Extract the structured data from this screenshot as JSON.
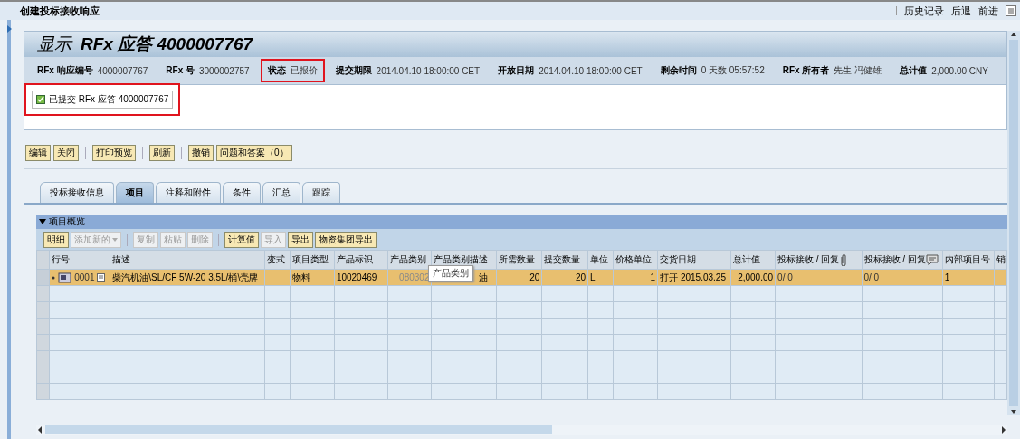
{
  "window": {
    "title": "创建投标接收响应"
  },
  "nav": [
    "历史记录",
    "后退",
    "前进"
  ],
  "header": {
    "title_prefix": "显示",
    "title": "RFx 应答 4000007767",
    "fields": [
      {
        "label": "RFx 响应编号",
        "value": "4000007767",
        "highlighted": false
      },
      {
        "label": "RFx 号",
        "value": "3000002757",
        "highlighted": false
      },
      {
        "label": "状态",
        "value": "已报价",
        "highlighted": true
      },
      {
        "label": "提交期限",
        "value": "2014.04.10 18:00:00 CET",
        "highlighted": false
      },
      {
        "label": "开放日期",
        "value": "2014.04.10 18:00:00 CET",
        "highlighted": false
      },
      {
        "label": "剩余时间",
        "value": "0 天数  05:57:52",
        "highlighted": false
      },
      {
        "label": "RFx 所有者",
        "value": "先生  冯健雄",
        "highlighted": false
      },
      {
        "label": "总计值",
        "value": "2,000.00 CNY",
        "highlighted": false
      }
    ]
  },
  "message": {
    "text": "已提交  RFx 应答  4000007767",
    "highlighted": true
  },
  "toolbar": [
    [
      "编辑",
      "关闭"
    ],
    [
      "打印预览"
    ],
    [
      "刷新"
    ],
    [
      "撤销",
      "问题和答案（0）"
    ]
  ],
  "tabs": [
    {
      "label": "投标接收信息",
      "selected": false
    },
    {
      "label": "项目",
      "selected": true
    },
    {
      "label": "注释和附件",
      "selected": false
    },
    {
      "label": "条件",
      "selected": false
    },
    {
      "label": "汇总",
      "selected": false
    },
    {
      "label": "跟踪",
      "selected": false
    }
  ],
  "section": {
    "title": "项目概览",
    "expanded": true
  },
  "table_toolbar": [
    [
      {
        "label": "明细",
        "disabled": false,
        "dropdown": false
      },
      {
        "label": "添加新的",
        "disabled": true,
        "dropdown": true
      }
    ],
    [
      {
        "label": "复制",
        "disabled": true,
        "dropdown": false
      },
      {
        "label": "粘贴",
        "disabled": true,
        "dropdown": false
      },
      {
        "label": "删除",
        "disabled": true,
        "dropdown": false
      }
    ],
    [
      {
        "label": "计算值",
        "disabled": false,
        "dropdown": false
      },
      {
        "label": "导入",
        "disabled": true,
        "dropdown": false
      },
      {
        "label": "导出",
        "disabled": false,
        "dropdown": false
      },
      {
        "label": "物资集团导出",
        "disabled": false,
        "dropdown": false
      }
    ]
  ],
  "table": {
    "columns": [
      "行号",
      "描述",
      "变式",
      "项目类型",
      "产品标识",
      "产品类别",
      "产品类别描述",
      "所需数量",
      "提交数量",
      "单位",
      "价格单位",
      "交货日期",
      "总计值",
      "投标接收 / 回复",
      "投标接收 / 回复",
      "内部项目号",
      "销"
    ],
    "rows": [
      {
        "selected": true,
        "cells": [
          "0001",
          "柴汽机油\\SL/CF 5W-20 3.5L/桶\\壳牌",
          "",
          "物料",
          "10020469",
          "080302",
          "油",
          "20",
          "20",
          "L",
          "1",
          "打开  2015.03.25",
          "2,000.00",
          "0/ 0",
          "0/ 0",
          "1",
          ""
        ]
      }
    ]
  },
  "tooltip": {
    "text": "产品类别"
  }
}
